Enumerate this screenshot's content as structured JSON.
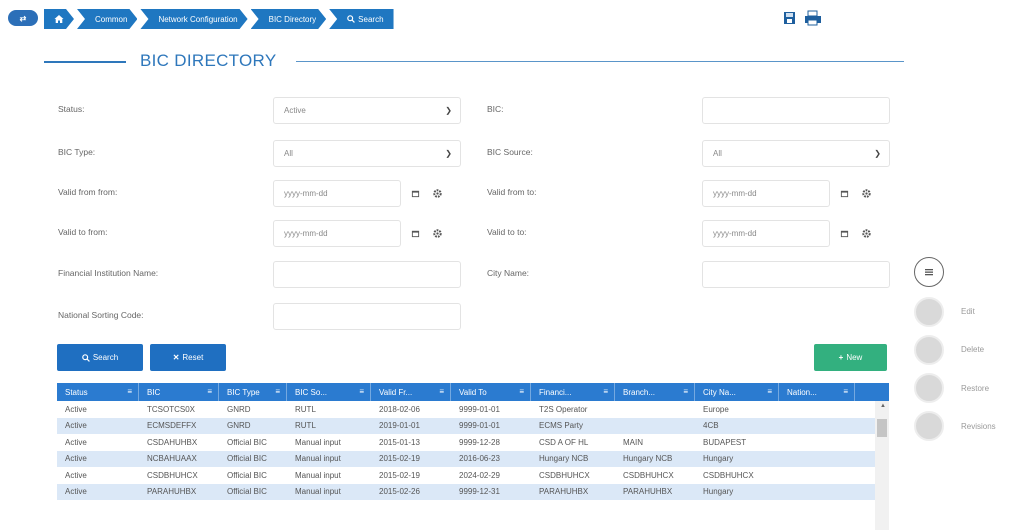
{
  "breadcrumb": {
    "toggle_label": "⇄",
    "items": [
      "Common",
      "Network Configuration",
      "BIC Directory",
      "Search"
    ]
  },
  "page": {
    "title": "BIC DIRECTORY"
  },
  "form": {
    "status_label": "Status:",
    "status_value": "Active",
    "bic_label": "BIC:",
    "bic_value": "",
    "bic_type_label": "BIC Type:",
    "bic_type_value": "All",
    "bic_source_label": "BIC Source:",
    "bic_source_value": "All",
    "valid_from_from_label": "Valid from from:",
    "valid_from_from_placeholder": "yyyy-mm-dd",
    "valid_from_to_label": "Valid from to:",
    "valid_from_to_placeholder": "yyyy-mm-dd",
    "valid_to_from_label": "Valid to from:",
    "valid_to_from_placeholder": "yyyy-mm-dd",
    "valid_to_to_label": "Valid to to:",
    "valid_to_to_placeholder": "yyyy-mm-dd",
    "fin_inst_label": "Financial Institution Name:",
    "city_label": "City Name:",
    "nsc_label": "National Sorting Code:"
  },
  "buttons": {
    "search": "Search",
    "reset": "Reset",
    "new": "New"
  },
  "side_actions": {
    "edit": "Edit",
    "delete": "Delete",
    "restore": "Restore",
    "revisions": "Revisions"
  },
  "table": {
    "headers": [
      "Status",
      "BIC",
      "BIC Type",
      "BIC So...",
      "Valid Fr...",
      "Valid To",
      "Financi...",
      "Branch...",
      "City Na...",
      "Nation..."
    ],
    "rows": [
      [
        "Active",
        "TCSOTCS0X",
        "GNRD",
        "RUTL",
        "2018-02-06",
        "9999-01-01",
        "T2S Operator",
        "",
        "Europe",
        ""
      ],
      [
        "Active",
        "ECMSDEFFX",
        "GNRD",
        "RUTL",
        "2019-01-01",
        "9999-01-01",
        "ECMS Party",
        "",
        "4CB",
        ""
      ],
      [
        "Active",
        "CSDAHUHBX",
        "Official BIC",
        "Manual input",
        "2015-01-13",
        "9999-12-28",
        "CSD A OF HL",
        "MAIN",
        "BUDAPEST",
        ""
      ],
      [
        "Active",
        "NCBAHUAAX",
        "Official BIC",
        "Manual input",
        "2015-02-19",
        "2016-06-23",
        "Hungary NCB",
        "Hungary NCB",
        "Hungary",
        ""
      ],
      [
        "Active",
        "CSDBHUHCX",
        "Official BIC",
        "Manual input",
        "2015-02-19",
        "2024-02-29",
        "CSDBHUHCX",
        "CSDBHUHCX",
        "CSDBHUHCX",
        ""
      ],
      [
        "Active",
        "PARAHUHBX",
        "Official BIC",
        "Manual input",
        "2015-02-26",
        "9999-12-31",
        "PARAHUHBX",
        "PARAHUHBX",
        "Hungary",
        ""
      ]
    ]
  },
  "colors": {
    "accent": "#2e77bb",
    "header": "#2b7bd0",
    "new_button": "#33b07f",
    "alt_row": "#dbe8f7"
  }
}
